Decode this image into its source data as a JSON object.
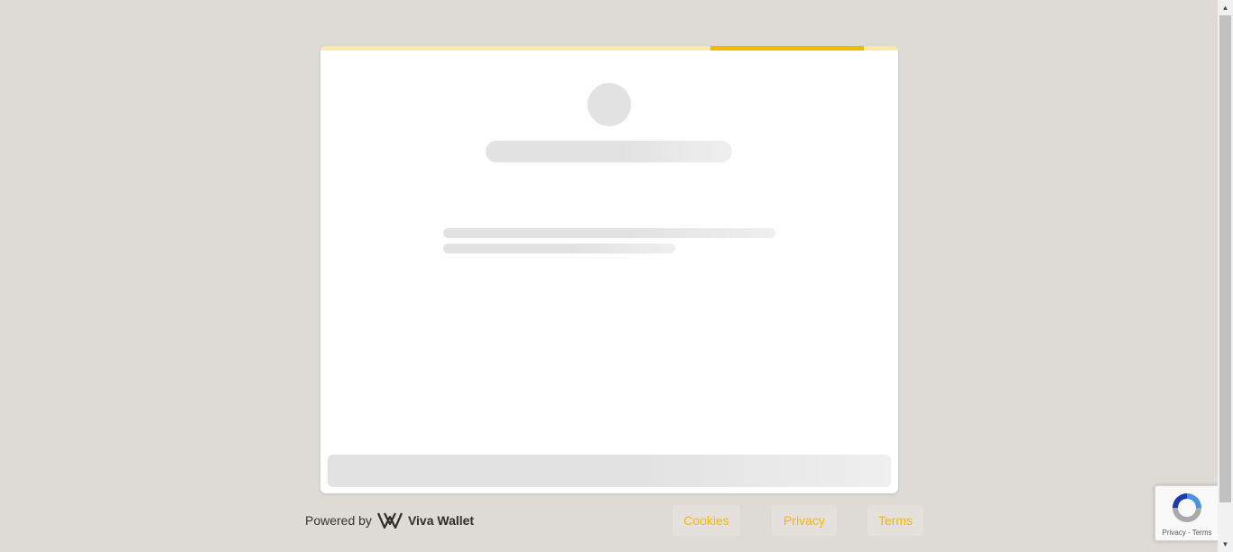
{
  "progress": {
    "start_fraction": 0.675,
    "end_fraction": 0.94
  },
  "footer": {
    "powered_by": "Powered by",
    "brand_name": "Viva Wallet",
    "links": {
      "cookies": "Cookies",
      "privacy": "Privacy",
      "terms": "Terms"
    }
  },
  "recaptcha": {
    "privacy": "Privacy",
    "separator": " - ",
    "terms": "Terms"
  },
  "colors": {
    "accent": "#f5b800",
    "accent_light": "#fbe9a9",
    "background": "#dedbd6",
    "skeleton": "#e2e2e2"
  }
}
